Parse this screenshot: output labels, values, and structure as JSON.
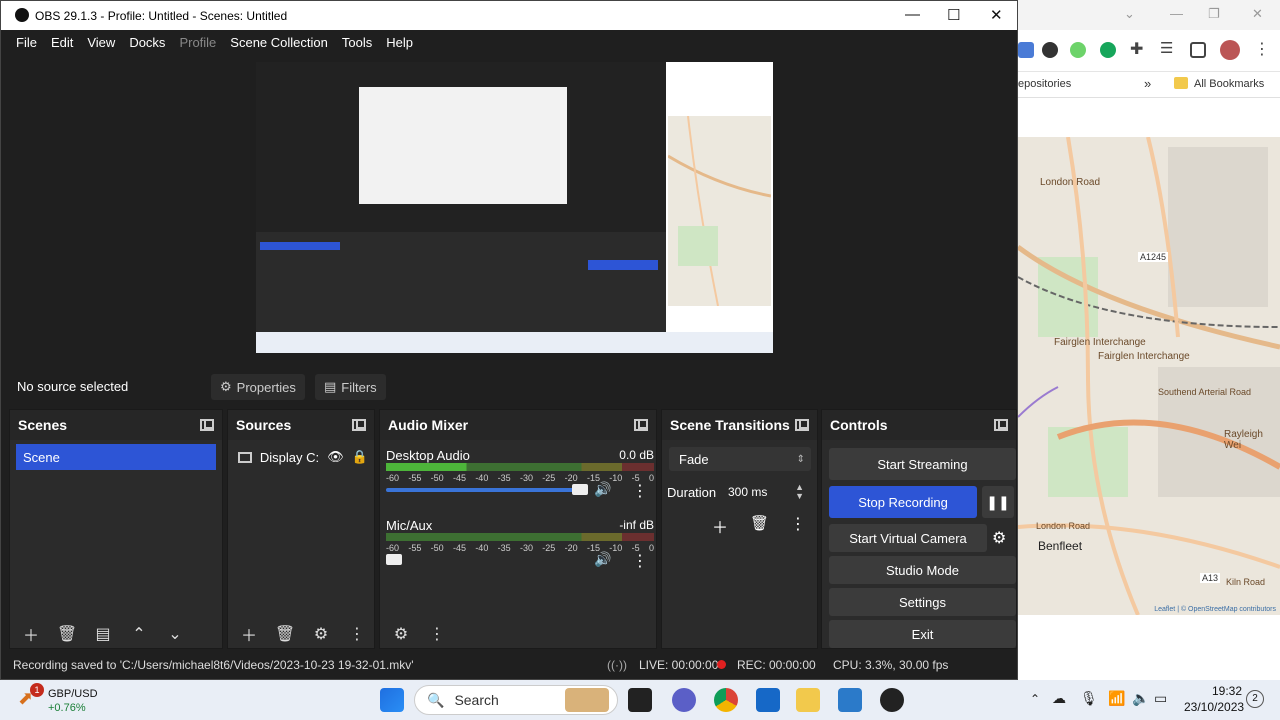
{
  "browser": {
    "bookmarks": {
      "repositories": "epositories",
      "all_bookmarks": "All Bookmarks"
    },
    "map_labels": {
      "london_road_top": "London Road",
      "a1245": "A1245",
      "fairglen_interchange_1": "Fairglen Interchange",
      "fairglen_interchange_2": "Fairglen Interchange",
      "southend_arterial": "Southend Arterial Road",
      "rayleigh_weir": "Rayleigh Wei",
      "london_road_bottom": "London Road",
      "benfleet": "Benfleet",
      "a13": "A13",
      "kiln_road": "Kiln Road",
      "attribution": "Leaflet | © OpenStreetMap contributors"
    }
  },
  "obs": {
    "title": "OBS 29.1.3 - Profile: Untitled - Scenes: Untitled",
    "menu": [
      "File",
      "Edit",
      "View",
      "Docks",
      "Profile",
      "Scene Collection",
      "Tools",
      "Help"
    ],
    "context_bar": {
      "no_source": "No source selected",
      "properties": "Properties",
      "filters": "Filters"
    },
    "scenes": {
      "title": "Scenes",
      "items": [
        "Scene"
      ]
    },
    "sources": {
      "title": "Sources",
      "items": [
        "Display C:"
      ]
    },
    "audio_mixer": {
      "title": "Audio Mixer",
      "scale": [
        "-60",
        "-55",
        "-50",
        "-45",
        "-40",
        "-35",
        "-30",
        "-25",
        "-20",
        "-15",
        "-10",
        "-5",
        "0"
      ],
      "channels": [
        {
          "name": "Desktop Audio",
          "db": "0.0 dB",
          "volume": 1.0
        },
        {
          "name": "Mic/Aux",
          "db": "-inf dB",
          "volume": 0.0
        }
      ]
    },
    "scene_transitions": {
      "title": "Scene Transitions",
      "transition": "Fade",
      "duration_label": "Duration",
      "duration_value": "300 ms"
    },
    "controls": {
      "title": "Controls",
      "start_streaming": "Start Streaming",
      "stop_recording": "Stop Recording",
      "start_virtual_camera": "Start Virtual Camera",
      "studio_mode": "Studio Mode",
      "settings": "Settings",
      "exit": "Exit"
    },
    "status": {
      "message": "Recording saved to 'C:/Users/michael8t6/Videos/2023-10-23 19-32-01.mkv'",
      "live": "LIVE: 00:00:00",
      "rec": "REC: 00:00:00",
      "cpu": "CPU: 3.3%, 30.00 fps"
    }
  },
  "taskbar": {
    "stock_name": "GBP/USD",
    "stock_change": "+0.76%",
    "stock_badge": "1",
    "search": "Search",
    "time": "19:32",
    "date": "23/10/2023",
    "notifications": "2"
  },
  "colors": {
    "accent": "#2d55d6",
    "record": "#e02020",
    "stock_up": "#1a7f37"
  }
}
